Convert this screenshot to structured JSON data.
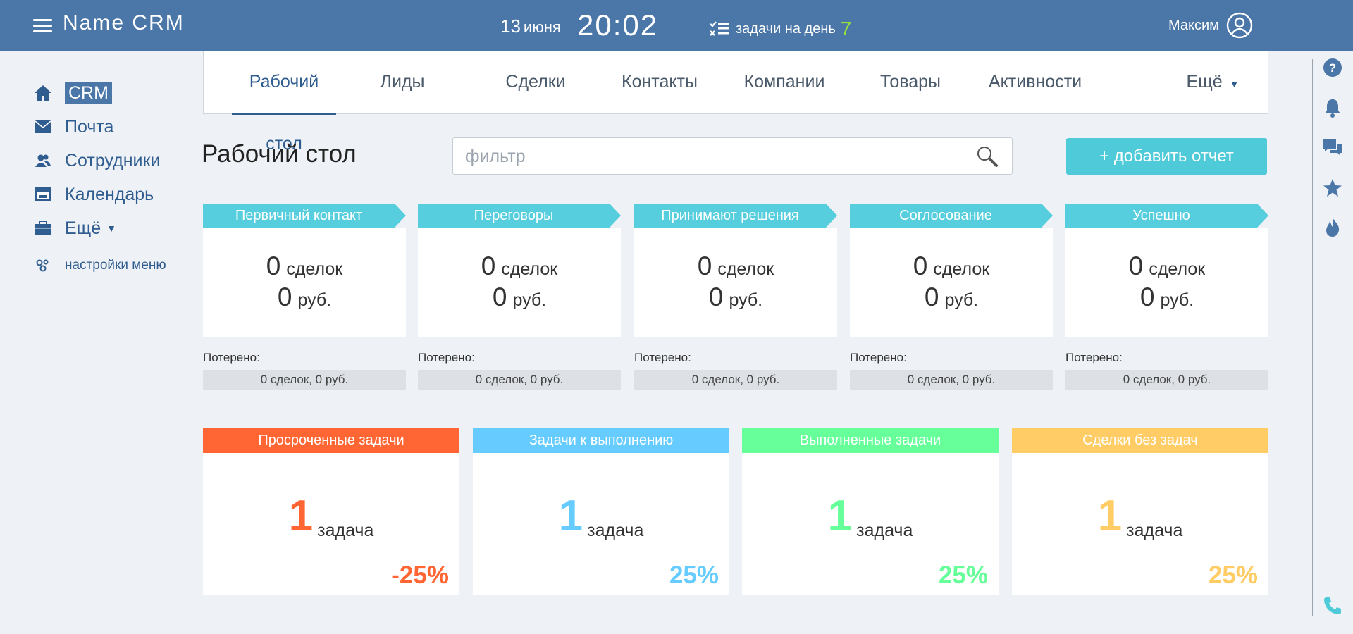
{
  "header": {
    "brand": "Name CRM",
    "date_day": "13",
    "date_month": "июня",
    "time": "20:02",
    "tasks_label": "задачи на день",
    "tasks_count": "7",
    "user_name": "Максим"
  },
  "nav": {
    "items": [
      {
        "label": "CRM",
        "icon": "home-icon"
      },
      {
        "label": "Почта",
        "icon": "mail-icon"
      },
      {
        "label": "Сотрудники",
        "icon": "users-icon"
      },
      {
        "label": "Календарь",
        "icon": "calendar-icon"
      },
      {
        "label": "Ещё",
        "icon": "briefcase-icon"
      }
    ],
    "settings": "настройки меню"
  },
  "tabs": [
    "Рабочий стол",
    "Лиды",
    "Сделки",
    "Контакты",
    "Компании",
    "Товары",
    "Активности",
    "Ещё"
  ],
  "page": {
    "title": "Рабочий стол",
    "filter_placeholder": "фильтр",
    "add_report": "+ добавить отчет"
  },
  "stages": [
    {
      "name": "Первичный контакт",
      "deals": "0",
      "deals_unit": "сделок",
      "sum": "0",
      "sum_unit": "руб.",
      "lost_label": "Потерено:",
      "lost": "0 сделок, 0 руб."
    },
    {
      "name": "Переговоры",
      "deals": "0",
      "deals_unit": "сделок",
      "sum": "0",
      "sum_unit": "руб.",
      "lost_label": "Потерено:",
      "lost": "0 сделок, 0 руб."
    },
    {
      "name": "Принимают решения",
      "deals": "0",
      "deals_unit": "сделок",
      "sum": "0",
      "sum_unit": "руб.",
      "lost_label": "Потерено:",
      "lost": "0 сделок, 0 руб."
    },
    {
      "name": "Соглосование",
      "deals": "0",
      "deals_unit": "сделок",
      "sum": "0",
      "sum_unit": "руб.",
      "lost_label": "Потерено:",
      "lost": "0 сделок, 0 руб."
    },
    {
      "name": "Успешно",
      "deals": "0",
      "deals_unit": "сделок",
      "sum": "0",
      "sum_unit": "руб.",
      "lost_label": "Потерено:",
      "lost": "0 сделок, 0 руб."
    }
  ],
  "task_cards": [
    {
      "title": "Просроченные задачи",
      "count": "1",
      "unit": "задача",
      "percent": "-25%",
      "color": "#ff6633"
    },
    {
      "title": "Задачи к выполнению",
      "count": "1",
      "unit": "задача",
      "percent": "25%",
      "color": "#66ccff"
    },
    {
      "title": "Выполненные задачи",
      "count": "1",
      "unit": "задача",
      "percent": "25%",
      "color": "#66ff99"
    },
    {
      "title": "Сделки без задач",
      "count": "1",
      "unit": "задача",
      "percent": "25%",
      "color": "#ffcc66"
    }
  ],
  "right_rail": [
    "help-icon",
    "bell-icon",
    "chat-icon",
    "star-icon",
    "fire-icon",
    "phone-icon"
  ],
  "colors": {
    "header": "#4a76a8",
    "accent": "#56cedd",
    "nav_text": "#2f5d8f"
  }
}
